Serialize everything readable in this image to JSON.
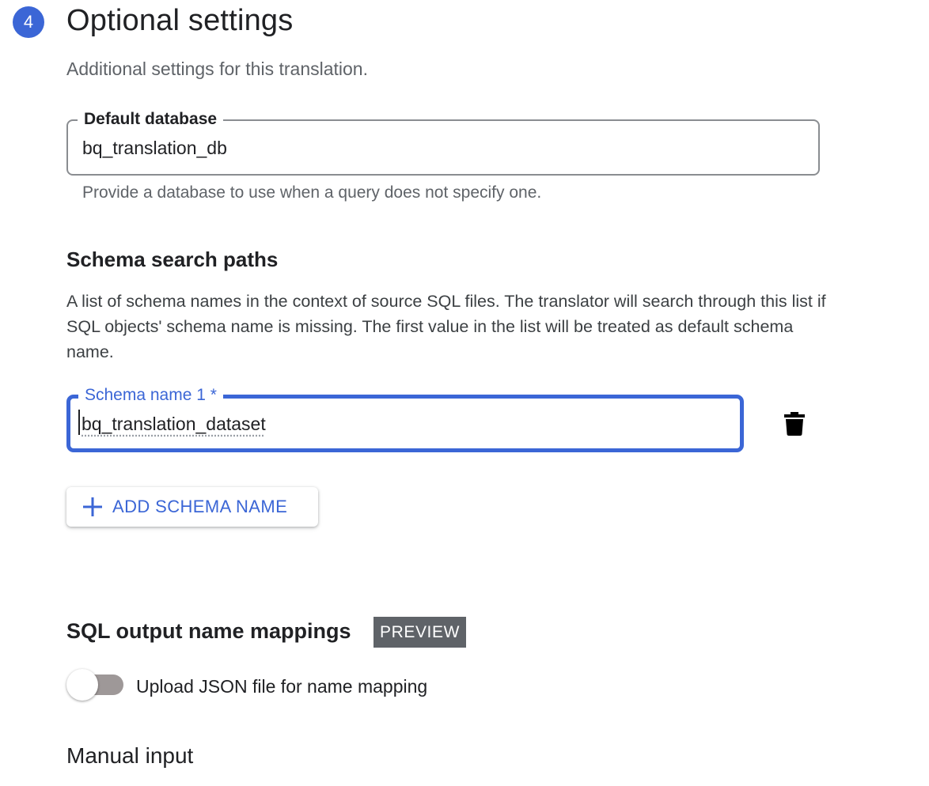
{
  "step": {
    "number": "4",
    "title": "Optional settings",
    "subtitle": "Additional settings for this translation."
  },
  "default_database": {
    "label": "Default database",
    "value": "bq_translation_db",
    "helper": "Provide a database to use when a query does not specify one."
  },
  "schema_search_paths": {
    "heading": "Schema search paths",
    "description": "A list of schema names in the context of source SQL files. The translator will search through this list if SQL objects' schema name is missing. The first value in the list will be treated as default schema name.",
    "fields": [
      {
        "label": "Schema name 1 *",
        "value": "bq_translation_dataset"
      }
    ],
    "delete_icon": "delete-icon",
    "add_button_label": "ADD SCHEMA NAME",
    "add_icon": "plus-icon"
  },
  "name_mappings": {
    "heading": "SQL output name mappings",
    "badge": "PREVIEW",
    "toggle_label": "Upload JSON file for name mapping",
    "toggle_on": false
  },
  "manual_input": {
    "heading": "Manual input"
  },
  "colors": {
    "accent": "#3b66d6",
    "badge_bg": "#5f6368",
    "text_primary": "#202124",
    "text_secondary": "#5f6368"
  }
}
